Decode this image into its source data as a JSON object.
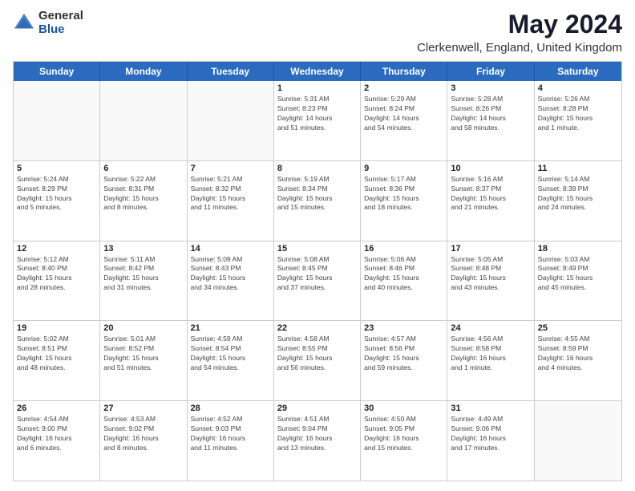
{
  "logo": {
    "general": "General",
    "blue": "Blue"
  },
  "title": "May 2024",
  "subtitle": "Clerkenwell, England, United Kingdom",
  "days": [
    "Sunday",
    "Monday",
    "Tuesday",
    "Wednesday",
    "Thursday",
    "Friday",
    "Saturday"
  ],
  "weeks": [
    [
      {
        "day": "",
        "content": ""
      },
      {
        "day": "",
        "content": ""
      },
      {
        "day": "",
        "content": ""
      },
      {
        "day": "1",
        "content": "Sunrise: 5:31 AM\nSunset: 8:23 PM\nDaylight: 14 hours\nand 51 minutes."
      },
      {
        "day": "2",
        "content": "Sunrise: 5:29 AM\nSunset: 8:24 PM\nDaylight: 14 hours\nand 54 minutes."
      },
      {
        "day": "3",
        "content": "Sunrise: 5:28 AM\nSunset: 8:26 PM\nDaylight: 14 hours\nand 58 minutes."
      },
      {
        "day": "4",
        "content": "Sunrise: 5:26 AM\nSunset: 8:28 PM\nDaylight: 15 hours\nand 1 minute."
      }
    ],
    [
      {
        "day": "5",
        "content": "Sunrise: 5:24 AM\nSunset: 8:29 PM\nDaylight: 15 hours\nand 5 minutes."
      },
      {
        "day": "6",
        "content": "Sunrise: 5:22 AM\nSunset: 8:31 PM\nDaylight: 15 hours\nand 8 minutes."
      },
      {
        "day": "7",
        "content": "Sunrise: 5:21 AM\nSunset: 8:32 PM\nDaylight: 15 hours\nand 11 minutes."
      },
      {
        "day": "8",
        "content": "Sunrise: 5:19 AM\nSunset: 8:34 PM\nDaylight: 15 hours\nand 15 minutes."
      },
      {
        "day": "9",
        "content": "Sunrise: 5:17 AM\nSunset: 8:36 PM\nDaylight: 15 hours\nand 18 minutes."
      },
      {
        "day": "10",
        "content": "Sunrise: 5:16 AM\nSunset: 8:37 PM\nDaylight: 15 hours\nand 21 minutes."
      },
      {
        "day": "11",
        "content": "Sunrise: 5:14 AM\nSunset: 8:39 PM\nDaylight: 15 hours\nand 24 minutes."
      }
    ],
    [
      {
        "day": "12",
        "content": "Sunrise: 5:12 AM\nSunset: 8:40 PM\nDaylight: 15 hours\nand 28 minutes."
      },
      {
        "day": "13",
        "content": "Sunrise: 5:11 AM\nSunset: 8:42 PM\nDaylight: 15 hours\nand 31 minutes."
      },
      {
        "day": "14",
        "content": "Sunrise: 5:09 AM\nSunset: 8:43 PM\nDaylight: 15 hours\nand 34 minutes."
      },
      {
        "day": "15",
        "content": "Sunrise: 5:08 AM\nSunset: 8:45 PM\nDaylight: 15 hours\nand 37 minutes."
      },
      {
        "day": "16",
        "content": "Sunrise: 5:06 AM\nSunset: 8:46 PM\nDaylight: 15 hours\nand 40 minutes."
      },
      {
        "day": "17",
        "content": "Sunrise: 5:05 AM\nSunset: 8:48 PM\nDaylight: 15 hours\nand 43 minutes."
      },
      {
        "day": "18",
        "content": "Sunrise: 5:03 AM\nSunset: 8:49 PM\nDaylight: 15 hours\nand 45 minutes."
      }
    ],
    [
      {
        "day": "19",
        "content": "Sunrise: 5:02 AM\nSunset: 8:51 PM\nDaylight: 15 hours\nand 48 minutes."
      },
      {
        "day": "20",
        "content": "Sunrise: 5:01 AM\nSunset: 8:52 PM\nDaylight: 15 hours\nand 51 minutes."
      },
      {
        "day": "21",
        "content": "Sunrise: 4:59 AM\nSunset: 8:54 PM\nDaylight: 15 hours\nand 54 minutes."
      },
      {
        "day": "22",
        "content": "Sunrise: 4:58 AM\nSunset: 8:55 PM\nDaylight: 15 hours\nand 56 minutes."
      },
      {
        "day": "23",
        "content": "Sunrise: 4:57 AM\nSunset: 8:56 PM\nDaylight: 15 hours\nand 59 minutes."
      },
      {
        "day": "24",
        "content": "Sunrise: 4:56 AM\nSunset: 8:58 PM\nDaylight: 16 hours\nand 1 minute."
      },
      {
        "day": "25",
        "content": "Sunrise: 4:55 AM\nSunset: 8:59 PM\nDaylight: 16 hours\nand 4 minutes."
      }
    ],
    [
      {
        "day": "26",
        "content": "Sunrise: 4:54 AM\nSunset: 9:00 PM\nDaylight: 16 hours\nand 6 minutes."
      },
      {
        "day": "27",
        "content": "Sunrise: 4:53 AM\nSunset: 9:02 PM\nDaylight: 16 hours\nand 8 minutes."
      },
      {
        "day": "28",
        "content": "Sunrise: 4:52 AM\nSunset: 9:03 PM\nDaylight: 16 hours\nand 11 minutes."
      },
      {
        "day": "29",
        "content": "Sunrise: 4:51 AM\nSunset: 9:04 PM\nDaylight: 16 hours\nand 13 minutes."
      },
      {
        "day": "30",
        "content": "Sunrise: 4:50 AM\nSunset: 9:05 PM\nDaylight: 16 hours\nand 15 minutes."
      },
      {
        "day": "31",
        "content": "Sunrise: 4:49 AM\nSunset: 9:06 PM\nDaylight: 16 hours\nand 17 minutes."
      },
      {
        "day": "",
        "content": ""
      }
    ]
  ]
}
